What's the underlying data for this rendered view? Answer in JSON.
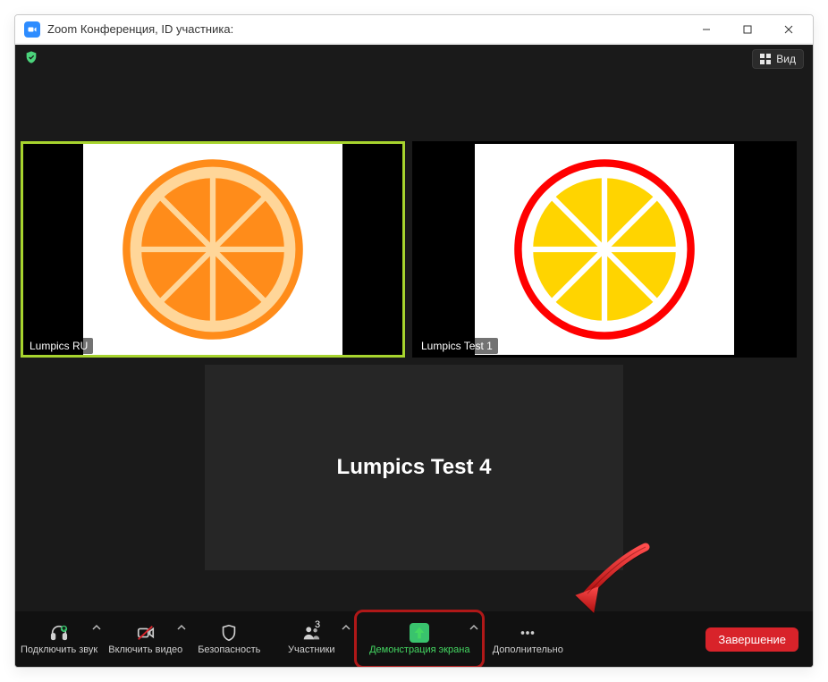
{
  "window": {
    "title": "Zoom Конференция, ID участника:"
  },
  "topbar": {
    "view_label": "Вид"
  },
  "tiles": [
    {
      "name": "Lumpics RU"
    },
    {
      "name": "Lumpics Test 1"
    }
  ],
  "main_tile": {
    "name": "Lumpics Test 4"
  },
  "toolbar": {
    "audio": "Подключить звук",
    "video": "Включить видео",
    "security": "Безопасность",
    "participants": "Участники",
    "participants_count": "3",
    "share": "Демонстрация экрана",
    "more": "Дополнительно",
    "end": "Завершение"
  }
}
